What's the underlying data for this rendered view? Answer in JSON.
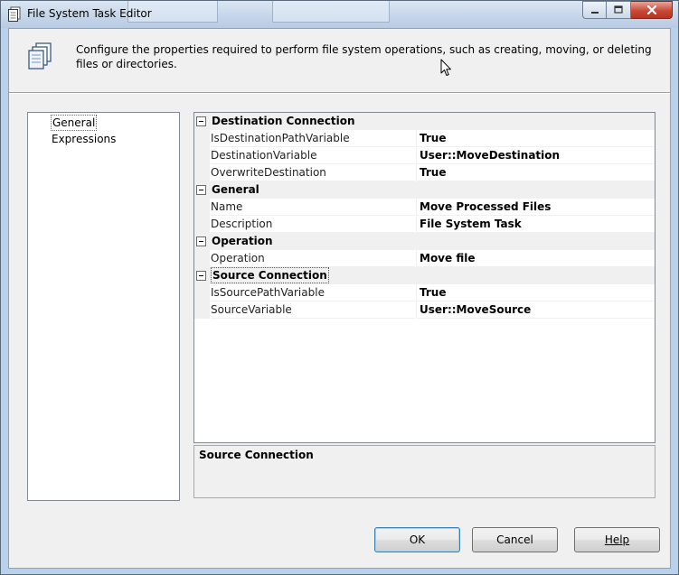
{
  "window": {
    "title": "File System Task Editor",
    "icon": "document-icon",
    "caption_buttons": [
      "minimize-icon",
      "maximize-icon",
      "close-icon"
    ]
  },
  "header": {
    "icon": "copy-files-icon",
    "description": "Configure the properties required to perform file system operations, such as creating, moving, or deleting files or directories."
  },
  "nav": {
    "items": [
      {
        "label": "General",
        "selected": true
      },
      {
        "label": "Expressions",
        "selected": false
      }
    ]
  },
  "grid": {
    "categories": [
      {
        "label": "Destination Connection",
        "properties": [
          {
            "name": "IsDestinationPathVariable",
            "value": "True"
          },
          {
            "name": "DestinationVariable",
            "value": "User::MoveDestination"
          },
          {
            "name": "OverwriteDestination",
            "value": "True"
          }
        ]
      },
      {
        "label": "General",
        "properties": [
          {
            "name": "Name",
            "value": "Move Processed Files"
          },
          {
            "name": "Description",
            "value": "File System Task"
          }
        ]
      },
      {
        "label": "Operation",
        "properties": [
          {
            "name": "Operation",
            "value": "Move file"
          }
        ]
      },
      {
        "label": "Source Connection",
        "properties": [
          {
            "name": "IsSourcePathVariable",
            "value": "True"
          },
          {
            "name": "SourceVariable",
            "value": "User::MoveSource"
          }
        ]
      }
    ]
  },
  "description_pane": {
    "title": "Source Connection"
  },
  "buttons": {
    "ok": "OK",
    "cancel": "Cancel",
    "help": "Help"
  },
  "colors": {
    "titlebar": "#c6d6ea",
    "dialog_bg": "#f0f0f0",
    "close_button": "#c74a36",
    "default_button_border": "#3c7fb1"
  }
}
